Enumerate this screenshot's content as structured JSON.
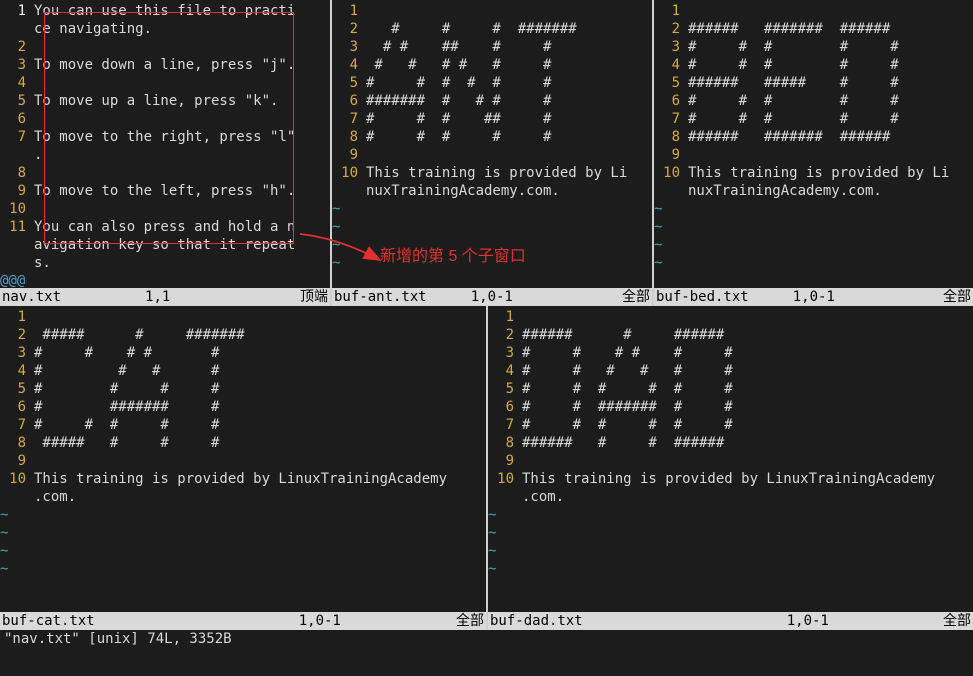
{
  "annotation": {
    "label": "新增的第 5 个子窗口"
  },
  "cmdline": "\"nav.txt\" [unix] 74L, 3352B",
  "windows": {
    "top": {
      "nav": {
        "status": {
          "name": "nav.txt",
          "pos": "1,1",
          "end": "顶端"
        },
        "at_rows": [
          "@@@"
        ],
        "lines": [
          {
            "n": "1",
            "t": "You can use this file to practi",
            "active": true
          },
          {
            "n": "",
            "t": "ce navigating."
          },
          {
            "n": "2",
            "t": ""
          },
          {
            "n": "3",
            "t": "To move down a line, press \"j\"."
          },
          {
            "n": "4",
            "t": ""
          },
          {
            "n": "5",
            "t": "To move up a line, press \"k\"."
          },
          {
            "n": "6",
            "t": ""
          },
          {
            "n": "7",
            "t": "To move to the right, press \"l\""
          },
          {
            "n": "",
            "t": "."
          },
          {
            "n": "8",
            "t": ""
          },
          {
            "n": "9",
            "t": "To move to the left, press \"h\"."
          },
          {
            "n": "10",
            "t": ""
          },
          {
            "n": "11",
            "t": "You can also press and hold a n"
          },
          {
            "n": "",
            "t": "avigation key so that it repeat"
          },
          {
            "n": "",
            "t": "s."
          }
        ]
      },
      "ant": {
        "status": {
          "name": "buf-ant.txt",
          "pos": "1,0-1",
          "end": "全部"
        },
        "tildes": 4,
        "lines": [
          {
            "n": "1",
            "t": ""
          },
          {
            "n": "2",
            "t": "   #     #     #  #######"
          },
          {
            "n": "3",
            "t": "  # #    ##    #     #"
          },
          {
            "n": "4",
            "t": " #   #   # #   #     #"
          },
          {
            "n": "5",
            "t": "#     #  #  #  #     #"
          },
          {
            "n": "6",
            "t": "#######  #   # #     #"
          },
          {
            "n": "7",
            "t": "#     #  #    ##     #"
          },
          {
            "n": "8",
            "t": "#     #  #     #     #"
          },
          {
            "n": "9",
            "t": ""
          },
          {
            "n": "10",
            "t": "This training is provided by Li"
          },
          {
            "n": "",
            "t": "nuxTrainingAcademy.com."
          }
        ]
      },
      "bed": {
        "status": {
          "name": "buf-bed.txt",
          "pos": "1,0-1",
          "end": "全部"
        },
        "tildes": 4,
        "lines": [
          {
            "n": "1",
            "t": ""
          },
          {
            "n": "2",
            "t": "######   #######  ######"
          },
          {
            "n": "3",
            "t": "#     #  #        #     #"
          },
          {
            "n": "4",
            "t": "#     #  #        #     #"
          },
          {
            "n": "5",
            "t": "######   #####    #     #"
          },
          {
            "n": "6",
            "t": "#     #  #        #     #"
          },
          {
            "n": "7",
            "t": "#     #  #        #     #"
          },
          {
            "n": "8",
            "t": "######   #######  ######"
          },
          {
            "n": "9",
            "t": ""
          },
          {
            "n": "10",
            "t": "This training is provided by Li"
          },
          {
            "n": "",
            "t": "nuxTrainingAcademy.com."
          }
        ]
      }
    },
    "bot": {
      "cat": {
        "status": {
          "name": "buf-cat.txt",
          "pos": "1,0-1",
          "end": "全部"
        },
        "tildes": 4,
        "lines": [
          {
            "n": "1",
            "t": ""
          },
          {
            "n": "2",
            "t": " #####      #     #######"
          },
          {
            "n": "3",
            "t": "#     #    # #       #"
          },
          {
            "n": "4",
            "t": "#         #   #      #"
          },
          {
            "n": "5",
            "t": "#        #     #     #"
          },
          {
            "n": "6",
            "t": "#        #######     #"
          },
          {
            "n": "7",
            "t": "#     #  #     #     #"
          },
          {
            "n": "8",
            "t": " #####   #     #     #"
          },
          {
            "n": "9",
            "t": ""
          },
          {
            "n": "10",
            "t": "This training is provided by LinuxTrainingAcademy"
          },
          {
            "n": "",
            "t": ".com."
          }
        ]
      },
      "dad": {
        "status": {
          "name": "buf-dad.txt",
          "pos": "1,0-1",
          "end": "全部"
        },
        "tildes": 4,
        "lines": [
          {
            "n": "1",
            "t": ""
          },
          {
            "n": "2",
            "t": "######      #     ######"
          },
          {
            "n": "3",
            "t": "#     #    # #    #     #"
          },
          {
            "n": "4",
            "t": "#     #   #   #   #     #"
          },
          {
            "n": "5",
            "t": "#     #  #     #  #     #"
          },
          {
            "n": "6",
            "t": "#     #  #######  #     #"
          },
          {
            "n": "7",
            "t": "#     #  #     #  #     #"
          },
          {
            "n": "8",
            "t": "######   #     #  ######"
          },
          {
            "n": "9",
            "t": ""
          },
          {
            "n": "10",
            "t": "This training is provided by LinuxTrainingAcademy"
          },
          {
            "n": "",
            "t": ".com."
          }
        ]
      }
    }
  }
}
